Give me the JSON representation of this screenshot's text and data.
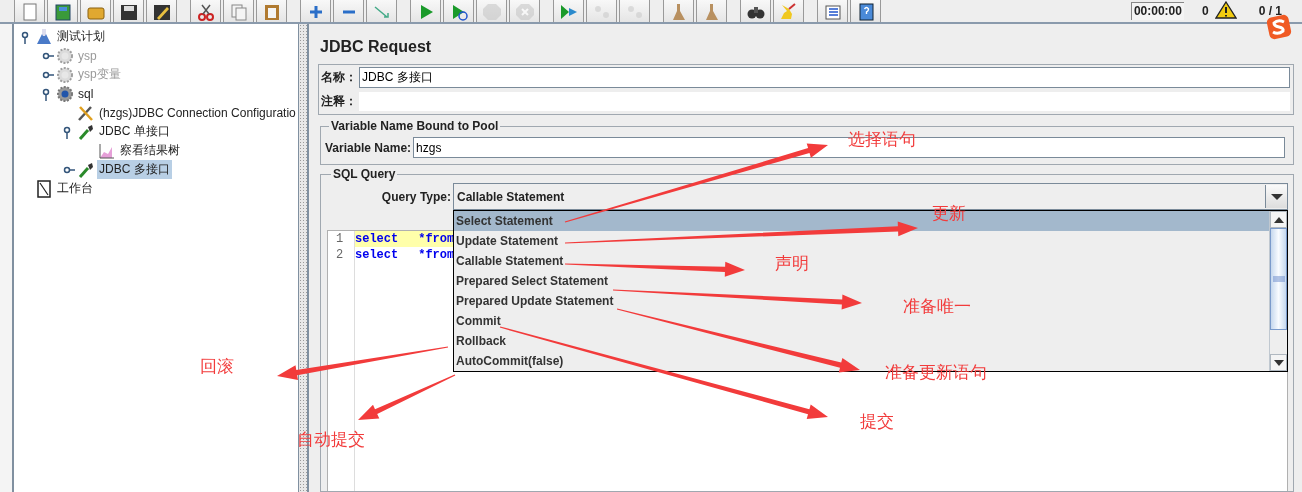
{
  "toolbar": {
    "buttons": [
      {
        "kind": "new",
        "disabled": false
      },
      {
        "kind": "templates",
        "disabled": false
      },
      {
        "kind": "open",
        "disabled": false
      },
      {
        "kind": "save",
        "disabled": false
      },
      {
        "kind": "save_as",
        "disabled": false
      },
      {
        "kind": "cut",
        "disabled": false
      },
      {
        "kind": "copy",
        "disabled": false
      },
      {
        "kind": "paste",
        "disabled": false
      },
      {
        "kind": "expand",
        "disabled": false
      },
      {
        "kind": "collapse",
        "disabled": false
      },
      {
        "kind": "toggle",
        "disabled": false
      },
      {
        "kind": "start",
        "disabled": false
      },
      {
        "kind": "start_no_timer",
        "disabled": false
      },
      {
        "kind": "stop",
        "disabled": true
      },
      {
        "kind": "shutdown",
        "disabled": true
      },
      {
        "kind": "remote_start",
        "disabled": false
      },
      {
        "kind": "remote_stop",
        "disabled": true
      },
      {
        "kind": "remote_shutdown",
        "disabled": true
      },
      {
        "kind": "clear",
        "disabled": false
      },
      {
        "kind": "clear_all",
        "disabled": false
      },
      {
        "kind": "search",
        "disabled": false
      },
      {
        "kind": "reset",
        "disabled": false
      },
      {
        "kind": "functions",
        "disabled": false
      },
      {
        "kind": "help",
        "disabled": false
      }
    ],
    "timer": "00:00:00",
    "warnings": "0",
    "threads": "0 / 1"
  },
  "tree": [
    {
      "label": "测试计划",
      "kind": "flask",
      "selected": false,
      "disabled": false,
      "expanded": true,
      "children": [
        {
          "label": "ysp",
          "kind": "gear",
          "selected": false,
          "disabled": true,
          "expanded": false
        },
        {
          "label": "ysp变量",
          "kind": "gear",
          "selected": false,
          "disabled": true,
          "expanded": false
        },
        {
          "label": "sql",
          "kind": "gear",
          "selected": false,
          "disabled": false,
          "expanded": true,
          "children": [
            {
              "label": "(hzgs)JDBC Connection Configuratio",
              "kind": "wrench",
              "selected": false,
              "disabled": false
            },
            {
              "label": "JDBC 单接口",
              "kind": "dropper",
              "selected": false,
              "disabled": false,
              "expanded": true,
              "children": [
                {
                  "label": "察看结果树",
                  "kind": "graph",
                  "selected": false,
                  "disabled": false
                }
              ]
            },
            {
              "label": "JDBC 多接口",
              "kind": "dropper",
              "selected": true,
              "disabled": false,
              "expanded": false
            }
          ]
        }
      ]
    },
    {
      "label": "工作台",
      "kind": "notebook",
      "selected": false,
      "disabled": false
    }
  ],
  "panel": {
    "title": "JDBC Request",
    "name_label": "名称：",
    "name_value": "JDBC 多接口",
    "comment_label": "注释：",
    "pool_group": {
      "legend": "Variable Name Bound to Pool",
      "label": "Variable Name:",
      "value": "hzgs"
    },
    "sql_group": {
      "legend": "SQL Query",
      "query_type_label": "Query Type:",
      "query_type_value": "Callable Statement",
      "dropdown": {
        "expanded": true,
        "options": [
          {
            "label": "Select Statement",
            "selected": true
          },
          {
            "label": "Update Statement",
            "selected": false
          },
          {
            "label": "Callable Statement",
            "selected": false
          },
          {
            "label": "Prepared Select Statement",
            "selected": false
          },
          {
            "label": "Prepared Update Statement",
            "selected": false
          },
          {
            "label": "Commit",
            "selected": false
          },
          {
            "label": "Rollback",
            "selected": false
          },
          {
            "label": "AutoCommit(false)",
            "selected": false
          }
        ]
      },
      "code_lines": [
        {
          "number": "1",
          "keyword": "select",
          "rest": "*from",
          "current": true
        },
        {
          "number": "2",
          "keyword": "select",
          "rest": "*from",
          "current": false
        }
      ]
    }
  },
  "annotations": [
    {
      "text": "选择语句"
    },
    {
      "text": "更新"
    },
    {
      "text": "声明"
    },
    {
      "text": "准备唯一"
    },
    {
      "text": "准备更新语句"
    },
    {
      "text": "回滚"
    },
    {
      "text": "自动提交"
    },
    {
      "text": "提交"
    }
  ]
}
